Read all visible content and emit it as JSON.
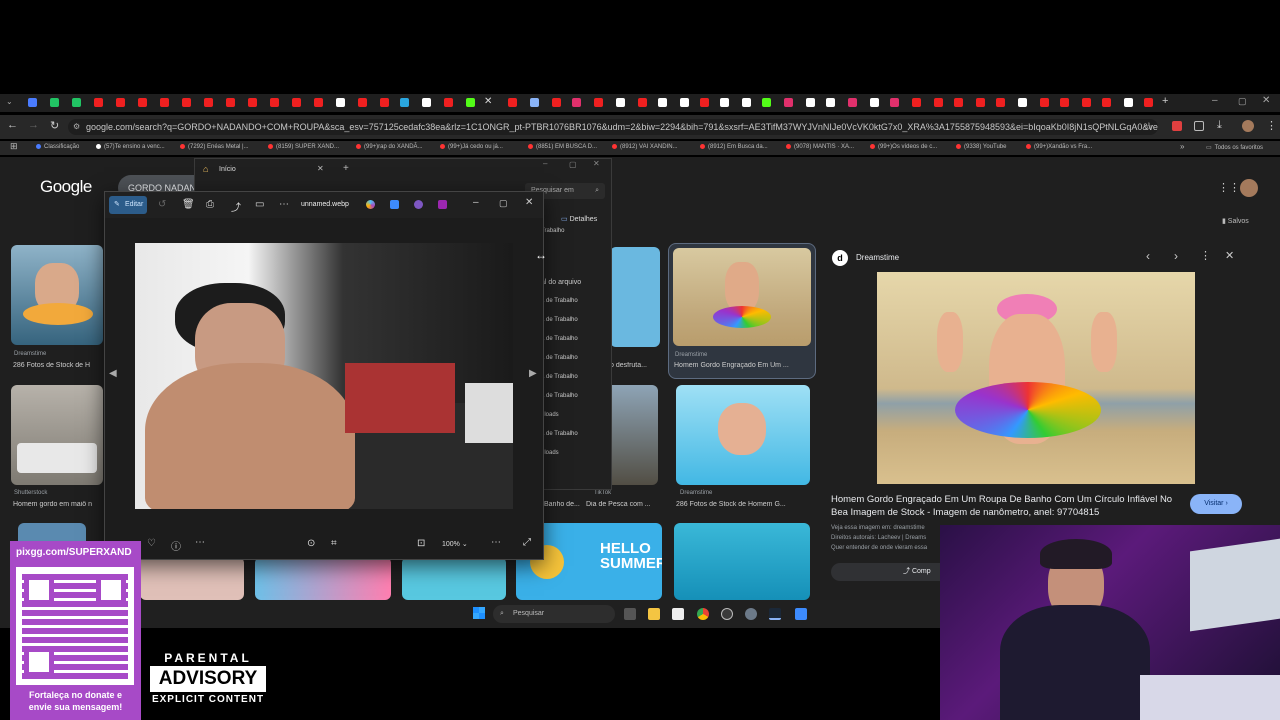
{
  "browser": {
    "url": "google.com/search?q=GORDO+NADANDO+COM+ROUPA&sca_esv=757125cedafc38ea&rlz=1C1ONGR_pt-PTBR1076BR1076&udm=2&biw=2294&bih=791&sxsrf=AE3TifM37WYJVnNIJe0VcVK0ktG7x0_XRA%3A1755875948593&ei=bIqoaKb0I8jN1sQPtNLGqA0&ved=0ahUKEwim2r3R256PAxXIppUCHTS...",
    "bookmarks": [
      "Classificação",
      "(57)Te ensino a venc...",
      "(7292) Enéas Metal |...",
      "(8159) SUPER XAND...",
      "(99+)rap do XANDÃ...",
      "(99+)Já cedo ou já...",
      "(8851) EM BUSCA D...",
      "(8912) VAI XANDIN...",
      "(8912) Em Busca da...",
      "(9078) MANTIS · XA...",
      "(99+)Os vídeos de c...",
      "(9338) YouTube",
      "(99+)Xandão vs Fra..."
    ],
    "all_bookmarks": "Todos os favoritos"
  },
  "google": {
    "logo": "Google",
    "search_text": "GORDO NADAN",
    "saved": "Salvos",
    "results": [
      {
        "source": "Dreamstime",
        "caption": "286 Fotos de Stock de H"
      },
      {
        "source": "",
        "caption": "o desfruta..."
      },
      {
        "source": "Dreamstime",
        "caption": "Homem Gordo Engraçado Em Um ..."
      },
      {
        "source": "Shutterstock",
        "caption": "Homem gordo em maiô n"
      },
      {
        "source": "",
        "caption": "Banho de..."
      },
      {
        "source": "TikTok",
        "caption": "Dia de Pesca com ..."
      },
      {
        "source": "Dreamstime",
        "caption": "286 Fotos de Stock de Homem G..."
      }
    ]
  },
  "panel": {
    "source": "Dreamstime",
    "title": "Homem Gordo Engraçado Em Um Roupa De Banho Com Um Círculo Inflável No Bea Imagem de Stock - Imagem de nanômetro, anel: 97704815",
    "visit": "Visitar",
    "more_at": "Veja essa imagem em: dreamstime",
    "rights": "Direitos autorais: Lacheev | Dreams",
    "understand": "Quer entender de onde vieram essa",
    "share": "Comp"
  },
  "explorer": {
    "tab_title": "Início",
    "search": "Pesquisar em",
    "details": "Detalhes",
    "items": [
      "Trabalho",
      "al do arquivo",
      "a de Trabalho",
      "a de Trabalho",
      "a de Trabalho",
      "a de Trabalho",
      "a de Trabalho",
      "a de Trabalho",
      "nloads",
      "a de Trabalho",
      "nloads"
    ]
  },
  "photos": {
    "edit": "Editar",
    "filename": "unnamed.webp",
    "zoom": "100%"
  },
  "taskbar": {
    "search": "Pesquisar"
  },
  "overlay": {
    "pix_url": "pixgg.com/SUPERXAND",
    "pix_msg": "Fortaleça no donate e envie sua mensagem!",
    "parental": "PARENTAL",
    "advisory": "ADVISORY",
    "explicit": "EXPLICIT CONTENT"
  }
}
